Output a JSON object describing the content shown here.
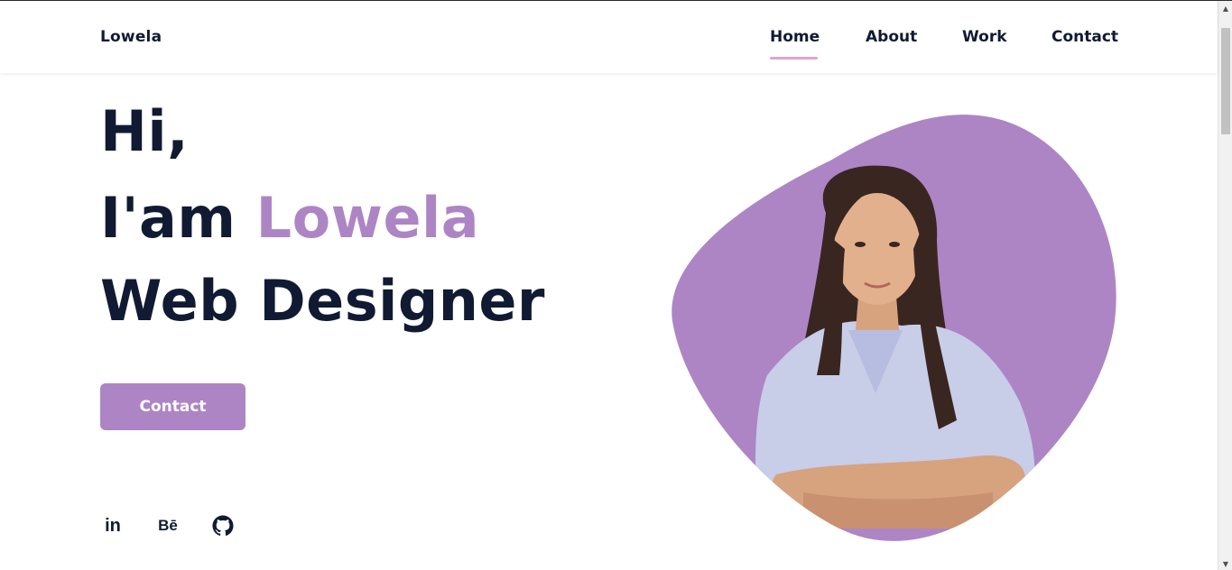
{
  "header": {
    "logo": "Lowela",
    "nav": [
      {
        "label": "Home",
        "active": true
      },
      {
        "label": "About",
        "active": false
      },
      {
        "label": "Work",
        "active": false
      },
      {
        "label": "Contact",
        "active": false
      }
    ]
  },
  "hero": {
    "line1": "Hi,",
    "line2_prefix": "I'am ",
    "line2_name": "Lowela",
    "line3": "Web Designer",
    "button_label": "Contact"
  },
  "socials": [
    {
      "name": "linkedin-icon",
      "glyph": "in"
    },
    {
      "name": "behance-icon",
      "glyph": "Bē"
    },
    {
      "name": "github-icon",
      "glyph": ""
    }
  ],
  "colors": {
    "accent": "#ad85c4",
    "text": "#111a33",
    "nav_underline": "#e0a3cf"
  }
}
